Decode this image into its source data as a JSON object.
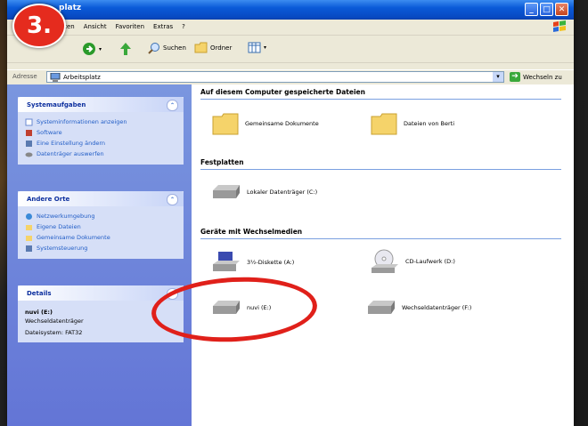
{
  "badge": {
    "number": "3."
  },
  "window": {
    "title": "platz",
    "buttons": {
      "minimize": "_",
      "maximize": "□",
      "close": "✕"
    }
  },
  "menu": {
    "items": [
      "eiten",
      "Ansicht",
      "Favoriten",
      "Extras",
      "?"
    ]
  },
  "toolbar": {
    "search": "Suchen",
    "folders": "Ordner"
  },
  "address": {
    "label": "Adresse",
    "value": "Arbeitsplatz",
    "go": "Wechseln zu"
  },
  "sidebar": {
    "system_tasks": {
      "title": "Systemaufgaben",
      "items": [
        "Systeminformationen anzeigen",
        "Software",
        "Eine Einstellung ändern",
        "Datenträger auswerfen"
      ]
    },
    "other_places": {
      "title": "Andere Orte",
      "items": [
        "Netzwerkumgebung",
        "Eigene Dateien",
        "Gemeinsame Dokumente",
        "Systemsteuerung"
      ]
    },
    "details": {
      "title": "Details",
      "name": "nuvi (E:)",
      "type": "Wechseldatenträger",
      "fs": "Dateisystem: FAT32"
    }
  },
  "main": {
    "groups": [
      {
        "title": "Auf diesem Computer gespeicherte Dateien",
        "items": [
          "Gemeinsame Dokumente",
          "Dateien von Berti"
        ]
      },
      {
        "title": "Festplatten",
        "items": [
          "Lokaler Datenträger (C:)"
        ]
      },
      {
        "title": "Geräte mit Wechselmedien",
        "items": [
          "3½-Diskette (A:)",
          "CD-Laufwerk (D:)",
          "nuvi (E:)",
          "Wechseldatenträger (F:)"
        ]
      }
    ]
  },
  "colors": {
    "badge": "#e52b1e",
    "highlight_circle": "#e0201a",
    "link": "#215dc6"
  }
}
